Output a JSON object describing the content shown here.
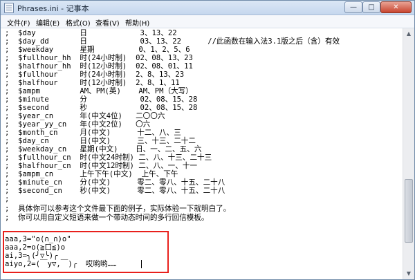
{
  "window": {
    "title": "Phrases.ini - 记事本",
    "minimize_label": "—",
    "maximize_label": "□",
    "close_label": "✕"
  },
  "menu": [
    {
      "label": "文件(F)"
    },
    {
      "label": "编辑(E)"
    },
    {
      "label": "格式(O)"
    },
    {
      "label": "查看(V)"
    },
    {
      "label": "帮助(H)"
    }
  ],
  "editor": {
    "lines": [
      ";  $day          日            3、13、22",
      ";  $day_dd       日            03、13、22      //此函数在输入法3.1版之后（含）有效",
      ";  $weekday      星期          0、1、2、5、6",
      ";  $fullhour_hh  时(24小时制)  02、08、13、23",
      ";  $halfhour_hh  时(12小时制)  02、08、01、11",
      ";  $fullhour     时(24小时制)  2、8、13、23",
      ";  $halfhour     时(12小时制)  2、8、1、11",
      ";  $ampm         AM、PM(英)    AM、PM（大写）",
      ";  $minute       分            02、08、15、28",
      ";  $second       秒            02、08、15、28",
      ";  $year_cn      年(中文4位)   二〇〇六",
      ";  $year_yy_cn   年(中文2位)   〇六",
      ";  $month_cn     月(中文)      十二、八、三",
      ";  $day_cn       日(中文)      三、十三、二十二",
      ";  $weekday_cn   星期(中文)    日、一、二、五、六",
      ";  $fullhour_cn  时(中文24时制) 二、八、十三、二十三",
      ";  $halfhour_cn  时(中文12时制) 二、八、一、十一",
      ";  $ampm_cn      上午下午(中文)  上午、下午",
      ";  $minute_cn    分(中文)      零二、零八、十五、二十八",
      ";  $second_cn    秒(中文)      零二、零八、十五、二十八",
      ";",
      ";  具体你可以参考这个文件最下面的例子，实际体验一下就明白了。",
      ";  你可以用自定义短语来做一个带动态时间的多行回信模板。",
      "",
      "aaa,3=\"o(∩_∩)o\"",
      "aaa,2=o(≧口≦)o",
      "ai,3=╮(╯▽╰)╭",
      "aiyo,2=(￣y▽,￣)╭  哎哟哟……"
    ]
  },
  "colors": {
    "highlight_border": "#e8201c"
  }
}
